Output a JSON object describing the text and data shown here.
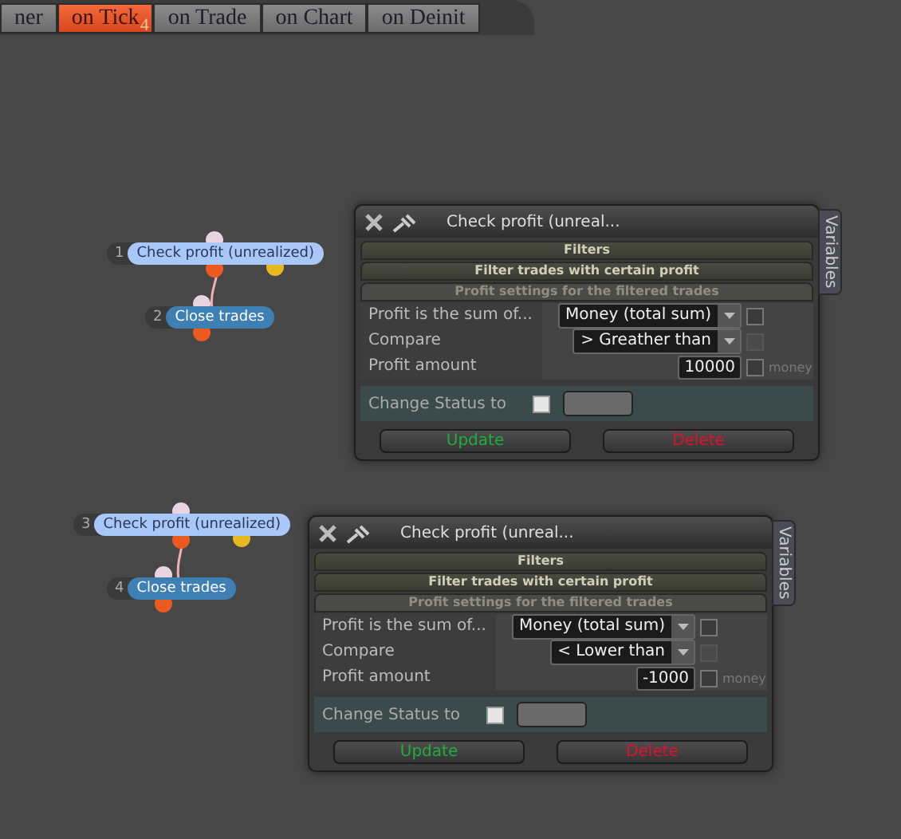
{
  "tabs": [
    {
      "label": "ner",
      "selected": false
    },
    {
      "label": "on Tick",
      "selected": true,
      "badge": "4"
    },
    {
      "label": "on Trade",
      "selected": false
    },
    {
      "label": "on Chart",
      "selected": false
    },
    {
      "label": "on Deinit",
      "selected": false
    }
  ],
  "nodes": [
    {
      "number": "1",
      "label": "Check profit (unrealized)",
      "kind": "condition"
    },
    {
      "number": "2",
      "label": "Close trades",
      "kind": "action"
    },
    {
      "number": "3",
      "label": "Check profit (unrealized)",
      "kind": "condition"
    },
    {
      "number": "4",
      "label": "Close trades",
      "kind": "action"
    }
  ],
  "panels": [
    {
      "title": "Check profit (unreal...",
      "side_tab": "Variables",
      "sections": [
        "Filters",
        "Filter trades with certain profit"
      ],
      "subsection": "Profit settings for the filtered trades",
      "rows": [
        {
          "kind": "select",
          "label": "Profit is the sum of...",
          "value": "Money (total sum)",
          "checkbox": {
            "checked": false,
            "disabled": false
          }
        },
        {
          "kind": "select",
          "label": "Compare",
          "value": "> Greather than",
          "checkbox": {
            "checked": false,
            "disabled": true
          }
        },
        {
          "kind": "number",
          "label": "Profit amount",
          "value": "10000",
          "checkbox": {
            "checked": false,
            "disabled": false
          },
          "suffix": "money"
        }
      ],
      "status": {
        "label": "Change Status to",
        "checked": false
      },
      "buttons": [
        {
          "label": "Update",
          "kind": "update"
        },
        {
          "label": "Delete",
          "kind": "delete"
        }
      ]
    },
    {
      "title": "Check profit (unreal...",
      "side_tab": "Variables",
      "sections": [
        "Filters",
        "Filter trades with certain profit"
      ],
      "subsection": "Profit settings for the filtered trades",
      "rows": [
        {
          "kind": "select",
          "label": "Profit is the sum of...",
          "value": "Money (total sum)",
          "checkbox": {
            "checked": false,
            "disabled": false
          }
        },
        {
          "kind": "select",
          "label": "Compare",
          "value": "< Lower than",
          "checkbox": {
            "checked": false,
            "disabled": true
          }
        },
        {
          "kind": "number",
          "label": "Profit amount",
          "value": "-1000",
          "checkbox": {
            "checked": false,
            "disabled": false
          },
          "suffix": "money"
        }
      ],
      "status": {
        "label": "Change Status to",
        "checked": false
      },
      "buttons": [
        {
          "label": "Update",
          "kind": "update"
        },
        {
          "label": "Delete",
          "kind": "delete"
        }
      ]
    }
  ]
}
